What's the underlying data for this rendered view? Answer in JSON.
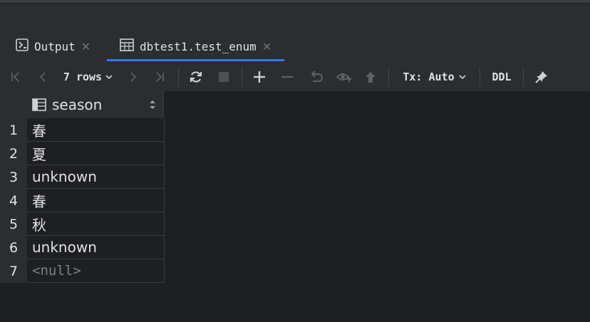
{
  "tabs": [
    {
      "label": "Output",
      "icon": "console-icon",
      "active": false
    },
    {
      "label": "dbtest1.test_enum",
      "icon": "table-icon",
      "active": true
    }
  ],
  "toolbar": {
    "rows_label": "7 rows",
    "tx_label": "Tx: Auto",
    "ddl_label": "DDL"
  },
  "table": {
    "column": "season",
    "rows": [
      {
        "num": "1",
        "value": "春"
      },
      {
        "num": "2",
        "value": "夏"
      },
      {
        "num": "3",
        "value": "unknown"
      },
      {
        "num": "4",
        "value": "春"
      },
      {
        "num": "5",
        "value": "秋"
      },
      {
        "num": "6",
        "value": "unknown"
      },
      {
        "num": "7",
        "value": "<null>"
      }
    ]
  },
  "colors": {
    "accent": "#3574f0",
    "background": "#2b2d30",
    "grid_background": "#1e1f22",
    "null_text": "#7b8089"
  }
}
